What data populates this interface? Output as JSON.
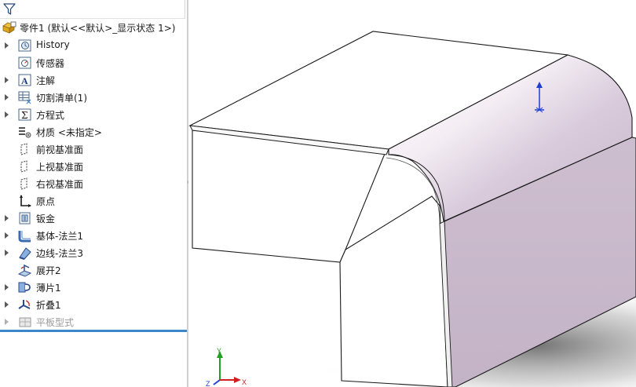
{
  "feature_tree": {
    "root_label": "零件1  (默认<<默认>_显示状态 1>)",
    "items": [
      {
        "label": "History",
        "icon": "history-icon",
        "expandable": true,
        "dim": false
      },
      {
        "label": "传感器",
        "icon": "sensor-icon",
        "expandable": false,
        "dim": false
      },
      {
        "label": "注解",
        "icon": "annotation-icon",
        "expandable": true,
        "dim": false
      },
      {
        "label": "切割清单(1)",
        "icon": "cut-list-icon",
        "expandable": true,
        "dim": false
      },
      {
        "label": "方程式",
        "icon": "equation-icon",
        "expandable": true,
        "dim": false
      },
      {
        "label": "材质 <未指定>",
        "icon": "material-icon",
        "expandable": false,
        "dim": false
      },
      {
        "label": "前视基准面",
        "icon": "plane-icon",
        "expandable": false,
        "dim": false
      },
      {
        "label": "上视基准面",
        "icon": "plane-icon",
        "expandable": false,
        "dim": false
      },
      {
        "label": "右视基准面",
        "icon": "plane-icon",
        "expandable": false,
        "dim": false
      },
      {
        "label": "原点",
        "icon": "origin-icon",
        "expandable": false,
        "dim": false
      },
      {
        "label": "钣金",
        "icon": "sheet-metal-icon",
        "expandable": true,
        "dim": false
      },
      {
        "label": "基体-法兰1",
        "icon": "base-flange-icon",
        "expandable": true,
        "dim": false
      },
      {
        "label": "边线-法兰3",
        "icon": "edge-flange-icon",
        "expandable": true,
        "dim": false
      },
      {
        "label": "展开2",
        "icon": "unfold-icon",
        "expandable": false,
        "dim": false
      },
      {
        "label": "薄片1",
        "icon": "tab-icon",
        "expandable": true,
        "dim": false
      },
      {
        "label": "折叠1",
        "icon": "fold-icon",
        "expandable": true,
        "dim": false
      },
      {
        "label": "平板型式",
        "icon": "flat-pattern-icon",
        "expandable": true,
        "dim": true
      }
    ]
  },
  "triad": {
    "x_label": "X",
    "y_label": "Y",
    "z_label": "Z"
  },
  "colors": {
    "accent": "#3a86c8",
    "selected_face": "#c9b8cc",
    "origin_blue": "#1f3fd0",
    "axis_x": "#d02020",
    "axis_y": "#20a020",
    "axis_z": "#2040d0"
  }
}
